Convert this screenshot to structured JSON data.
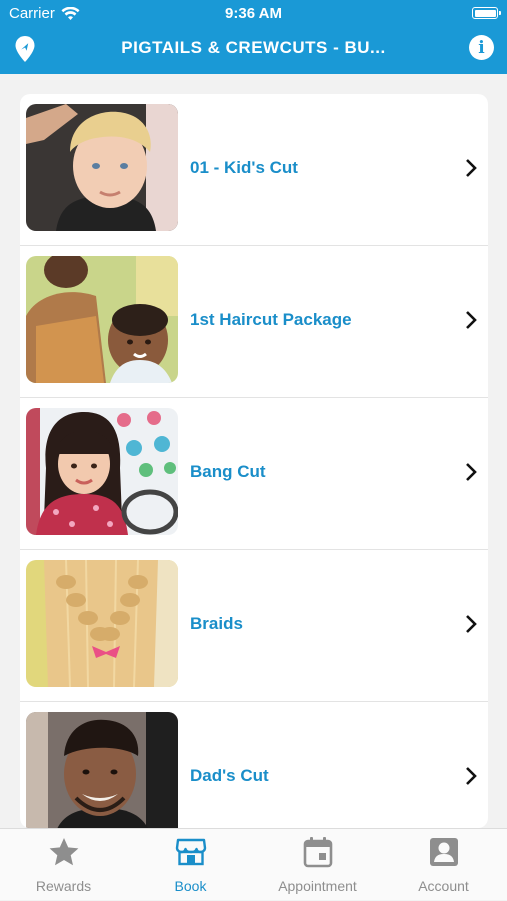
{
  "status_bar": {
    "carrier": "Carrier",
    "time": "9:36 AM"
  },
  "nav": {
    "title": "PIGTAILS & CREWCUTS - BU...",
    "left_icon": "location-pin-icon",
    "right_icon": "info-icon",
    "info_glyph": "i"
  },
  "services": [
    {
      "label": "01 - Kid's Cut",
      "image": "boy-blonde-haircut-photo"
    },
    {
      "label": "1st Haircut Package",
      "image": "toddler-first-haircut-photo"
    },
    {
      "label": "Bang Cut",
      "image": "girl-bangs-photo"
    },
    {
      "label": "Braids",
      "image": "braided-hair-photo"
    },
    {
      "label": "Dad's Cut",
      "image": "man-haircut-photo"
    }
  ],
  "tabs": [
    {
      "label": "Rewards",
      "icon": "star-icon",
      "active": false
    },
    {
      "label": "Book",
      "icon": "storefront-icon",
      "active": true
    },
    {
      "label": "Appointment",
      "icon": "calendar-icon",
      "active": false
    },
    {
      "label": "Account",
      "icon": "account-icon",
      "active": false
    }
  ],
  "colors": {
    "brand_blue": "#1a99d6",
    "link_blue": "#1a8ec9",
    "inactive_gray": "#8e8e8e"
  }
}
